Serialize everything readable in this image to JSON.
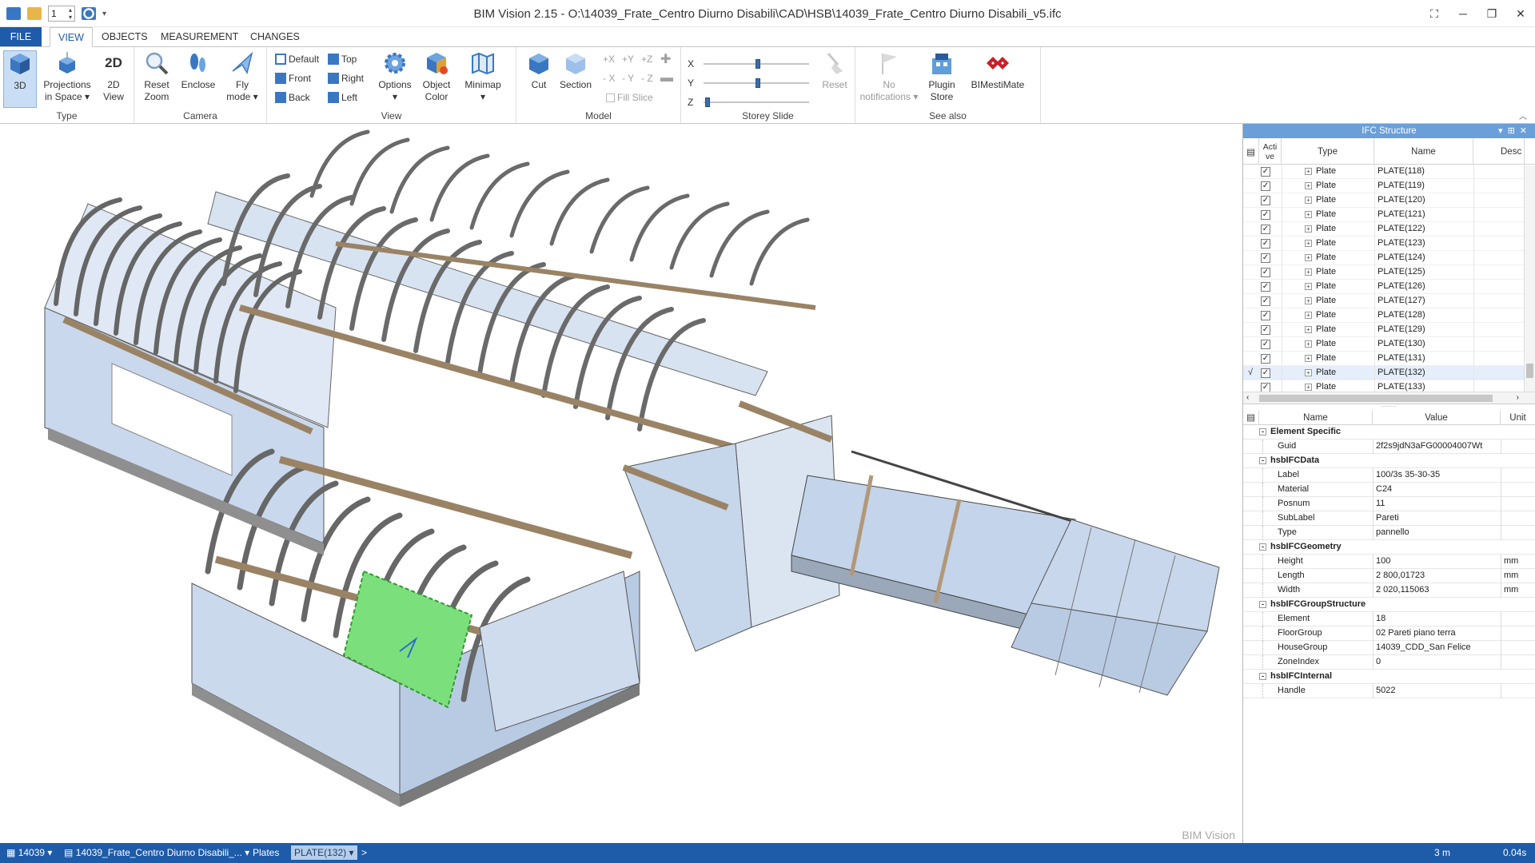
{
  "window": {
    "title": "BIM Vision 2.15 - O:\\14039_Frate_Centro Diurno Disabili\\CAD\\HSB\\14039_Frate_Centro Diurno Disabili_v5.ifc",
    "qat_value": "1"
  },
  "tabs": [
    "FILE",
    "VIEW",
    "OBJECTS",
    "MEASUREMENT",
    "CHANGES"
  ],
  "ribbon": {
    "type": {
      "label": "Type",
      "btn_3d": "3D",
      "btn_proj1": "Projections",
      "btn_proj2": "in Space",
      "btn_2d1": "2D",
      "btn_2d2": "View"
    },
    "camera": {
      "label": "Camera",
      "reset1": "Reset",
      "reset2": "Zoom",
      "enclose": "Enclose",
      "fly1": "Fly",
      "fly2": "mode"
    },
    "view": {
      "label": "View",
      "default": "Default",
      "front": "Front",
      "back": "Back",
      "top": "Top",
      "right": "Right",
      "left": "Left",
      "options": "Options",
      "objcolor1": "Object",
      "objcolor2": "Color",
      "minimap": "Minimap"
    },
    "model": {
      "label": "Model",
      "cut": "Cut",
      "section": "Section",
      "px": "+X",
      "py": "+Y",
      "pz": "+Z",
      "mx": "- X",
      "my": "- Y",
      "mz": "- Z",
      "fill_slice": "Fill Slice"
    },
    "storey": {
      "label": "Storey Slide",
      "x": "X",
      "y": "Y",
      "z": "Z",
      "reset": "Reset"
    },
    "seealso": {
      "label": "See also",
      "notif1": "No",
      "notif2": "notifications",
      "plugin1": "Plugin",
      "plugin2": "Store",
      "bimesti": "BIMestiMate"
    }
  },
  "viewport": {
    "watermark": "BIM Vision"
  },
  "ifc_panel": {
    "title": "IFC Structure",
    "columns": {
      "active1": "Acti",
      "active2": "ve",
      "type": "Type",
      "name": "Name",
      "desc": "Desc"
    },
    "rows": [
      {
        "type": "Plate",
        "name": "PLATE(118)"
      },
      {
        "type": "Plate",
        "name": "PLATE(119)"
      },
      {
        "type": "Plate",
        "name": "PLATE(120)"
      },
      {
        "type": "Plate",
        "name": "PLATE(121)"
      },
      {
        "type": "Plate",
        "name": "PLATE(122)"
      },
      {
        "type": "Plate",
        "name": "PLATE(123)"
      },
      {
        "type": "Plate",
        "name": "PLATE(124)"
      },
      {
        "type": "Plate",
        "name": "PLATE(125)"
      },
      {
        "type": "Plate",
        "name": "PLATE(126)"
      },
      {
        "type": "Plate",
        "name": "PLATE(127)"
      },
      {
        "type": "Plate",
        "name": "PLATE(128)"
      },
      {
        "type": "Plate",
        "name": "PLATE(129)"
      },
      {
        "type": "Plate",
        "name": "PLATE(130)"
      },
      {
        "type": "Plate",
        "name": "PLATE(131)"
      },
      {
        "type": "Plate",
        "name": "PLATE(132)"
      },
      {
        "type": "Plate",
        "name": "PLATE(133)"
      }
    ],
    "selected_mark": "√"
  },
  "properties": {
    "columns": {
      "name": "Name",
      "value": "Value",
      "unit": "Unit"
    },
    "sections": [
      {
        "title": "Element Specific",
        "rows": [
          {
            "name": "Guid",
            "value": "2f2s9jdN3aFG00004007Wt",
            "unit": ""
          }
        ]
      },
      {
        "title": "hsbIFCData",
        "rows": [
          {
            "name": "Label",
            "value": "100/3s  35-30-35",
            "unit": ""
          },
          {
            "name": "Material",
            "value": "C24",
            "unit": ""
          },
          {
            "name": "Posnum",
            "value": " 11",
            "unit": ""
          },
          {
            "name": "SubLabel",
            "value": "Pareti",
            "unit": ""
          },
          {
            "name": "Type",
            "value": "pannello",
            "unit": ""
          }
        ]
      },
      {
        "title": "hsbIFCGeometry",
        "rows": [
          {
            "name": "Height",
            "value": "100",
            "unit": "mm"
          },
          {
            "name": "Length",
            "value": "2 800,01723",
            "unit": "mm"
          },
          {
            "name": "Width",
            "value": "2 020,115063",
            "unit": "mm"
          }
        ]
      },
      {
        "title": "hsbIFCGroupStructure",
        "rows": [
          {
            "name": "Element",
            "value": "18",
            "unit": ""
          },
          {
            "name": "FloorGroup",
            "value": "02 Pareti piano terra",
            "unit": ""
          },
          {
            "name": "HouseGroup",
            "value": "14039_CDD_San Felice",
            "unit": ""
          },
          {
            "name": "ZoneIndex",
            "value": "0",
            "unit": ""
          }
        ]
      },
      {
        "title": "hsbIFCInternal",
        "rows": [
          {
            "name": "Handle",
            "value": "5022",
            "unit": ""
          }
        ]
      }
    ]
  },
  "statusbar": {
    "project": "14039",
    "file": "14039_Frate_Centro Diurno Disabili_...",
    "crumb1": "Plates",
    "crumb2": "PLATE(132)",
    "arrow": ">",
    "scale": "3 m",
    "time": "0.04s"
  }
}
